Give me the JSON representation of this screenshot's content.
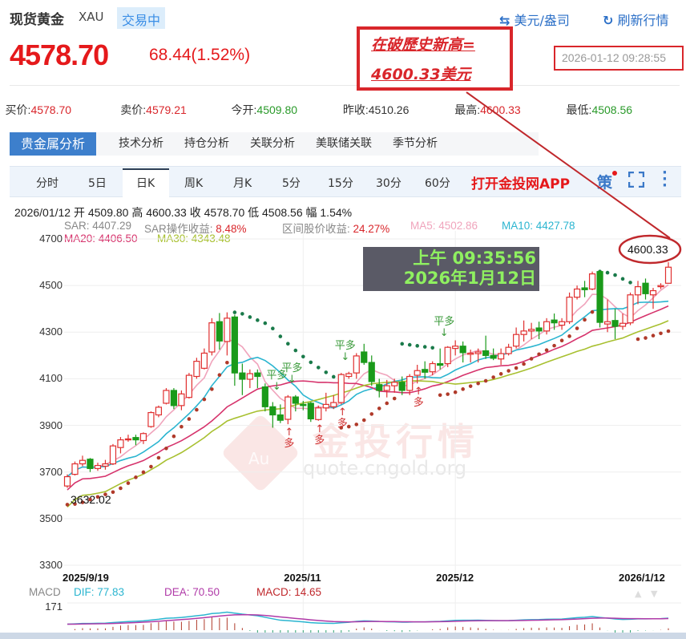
{
  "header": {
    "title": "现货黄金",
    "symbol": "XAU",
    "status": "交易中",
    "unit_btn": "美元/盎司",
    "refresh_btn": "刷新行情",
    "price": "4578.70",
    "change": "68.44(1.52%)",
    "timestamp": "2026-01-12 09:28:55"
  },
  "quote": [
    {
      "label": "买价:",
      "value": "4578.70",
      "color": "red"
    },
    {
      "label": "卖价:",
      "value": "4579.21",
      "color": "red"
    },
    {
      "label": "今开:",
      "value": "4509.80",
      "color": "green"
    },
    {
      "label": "昨收:",
      "value": "4510.26",
      "color": ""
    },
    {
      "label": "最高:",
      "value": "4600.33",
      "color": "red"
    },
    {
      "label": "最低:",
      "value": "4508.56",
      "color": "green"
    }
  ],
  "tabs": [
    "贵金属分析",
    "技术分析",
    "持仓分析",
    "关联分析",
    "美联储关联",
    "季节分析"
  ],
  "periods": [
    "分时",
    "5日",
    "日K",
    "周K",
    "月K",
    "5分",
    "15分",
    "30分",
    "60分"
  ],
  "app_link": "打开金投网APP",
  "strategy_label": "策",
  "info_line": "2026/01/12  开 4509.80  高 4600.33  收 4578.70  低 4508.56  幅 1.54%",
  "indicators": {
    "sar": "SAR: 4407.29",
    "sar_ret_label": "SAR操作收益: ",
    "sar_ret": "8.48%",
    "range_label": "区间股价收益: ",
    "range_ret": "24.27%",
    "ma5": "MA5: 4502.86",
    "ma10": "MA10: 4427.78",
    "ma20": "MA20: 4406.50",
    "ma30": "MA30: 4343.48"
  },
  "macd": {
    "label": "MACD",
    "dif": "DIF: 77.83",
    "dea": "DEA: 70.50",
    "macd": "MACD: 14.65",
    "axis": "171"
  },
  "annotations": {
    "callout_line1": "在破歷史新高=",
    "callout_line2": "4600.33美元",
    "time_line1": "上午 09:35:56",
    "time_line2": "2026年1月12日",
    "high_label": "4600.33",
    "low_label": "3632.02",
    "ping_duo": "平多",
    "duo": "多"
  },
  "watermark": {
    "text": "金投行情",
    "url": "quote.cngold.org",
    "logo": "Au"
  },
  "colors": {
    "up": "#e03030",
    "down": "#1a9a1a",
    "ma5": "#f0a4bc",
    "ma10": "#2bb5d0",
    "ma20": "#d6336c",
    "ma30": "#a8c030",
    "accent": "#3d7fcc"
  },
  "chart_data": {
    "type": "candlestick",
    "y_ticks": [
      4700,
      4500,
      4300,
      4100,
      3900,
      3700,
      3500,
      3300
    ],
    "ylim": [
      3300,
      4700
    ],
    "x_labels": [
      {
        "idx": 0,
        "label": "2025/9/19"
      },
      {
        "idx": 31,
        "label": "2025/11"
      },
      {
        "idx": 51,
        "label": "2025/12"
      },
      {
        "idx": 79,
        "label": "2026/1/12"
      }
    ],
    "signals_ping_duo": [
      27,
      29,
      36,
      49
    ],
    "signals_duo": [
      29,
      33,
      36,
      46
    ],
    "ohlc": [
      [
        3640,
        3690,
        3632.02,
        3680
      ],
      [
        3690,
        3745,
        3685,
        3735
      ],
      [
        3735,
        3770,
        3725,
        3750
      ],
      [
        3755,
        3760,
        3700,
        3715
      ],
      [
        3715,
        3740,
        3705,
        3728
      ],
      [
        3725,
        3752,
        3710,
        3735
      ],
      [
        3735,
        3820,
        3730,
        3812
      ],
      [
        3805,
        3850,
        3780,
        3838
      ],
      [
        3838,
        3860,
        3830,
        3842
      ],
      [
        3848,
        3860,
        3815,
        3838
      ],
      [
        3835,
        3870,
        3820,
        3865
      ],
      [
        3895,
        3960,
        3890,
        3955
      ],
      [
        3945,
        3985,
        3935,
        3978
      ],
      [
        3995,
        4060,
        3990,
        4050
      ],
      [
        4050,
        4060,
        3970,
        3985
      ],
      [
        3985,
        4050,
        3965,
        4035
      ],
      [
        4020,
        4125,
        4015,
        4115
      ],
      [
        4110,
        4190,
        4100,
        4175
      ],
      [
        4145,
        4230,
        4140,
        4210
      ],
      [
        4215,
        4360,
        4200,
        4340
      ],
      [
        4345,
        4382,
        4225,
        4262
      ],
      [
        4260,
        4385,
        4200,
        4360
      ],
      [
        4365,
        4375,
        4070,
        4125
      ],
      [
        4125,
        4165,
        4030,
        4098
      ],
      [
        4098,
        4140,
        4060,
        4122
      ],
      [
        4125,
        4140,
        4060,
        4110
      ],
      [
        4065,
        4080,
        3960,
        3980
      ],
      [
        3980,
        4000,
        3890,
        3945
      ],
      [
        3945,
        3990,
        3910,
        3922
      ],
      [
        3926,
        4030,
        3905,
        4022
      ],
      [
        4022,
        4030,
        3960,
        3995
      ],
      [
        3990,
        4005,
        3965,
        3985
      ],
      [
        3995,
        4000,
        3915,
        3928
      ],
      [
        3925,
        3985,
        3920,
        3975
      ],
      [
        3975,
        4040,
        3960,
        3990
      ],
      [
        3980,
        4030,
        3970,
        3998
      ],
      [
        3998,
        4125,
        3990,
        4118
      ],
      [
        4110,
        4130,
        4100,
        4122
      ],
      [
        4125,
        4210,
        4100,
        4198
      ],
      [
        4215,
        4250,
        4160,
        4170
      ],
      [
        4170,
        4200,
        4070,
        4088
      ],
      [
        4075,
        4100,
        4020,
        4050
      ],
      [
        4050,
        4095,
        4020,
        4070
      ],
      [
        4070,
        4100,
        4040,
        4085
      ],
      [
        4085,
        4110,
        4030,
        4050
      ],
      [
        4050,
        4120,
        4030,
        4110
      ],
      [
        4115,
        4160,
        4080,
        4135
      ],
      [
        4140,
        4175,
        4100,
        4128
      ],
      [
        4130,
        4175,
        4115,
        4165
      ],
      [
        4165,
        4230,
        4140,
        4158
      ],
      [
        4165,
        4240,
        4150,
        4235
      ],
      [
        4230,
        4265,
        4200,
        4240
      ],
      [
        4240,
        4260,
        4170,
        4212
      ],
      [
        4205,
        4225,
        4170,
        4210
      ],
      [
        4208,
        4230,
        4170,
        4215
      ],
      [
        4220,
        4285,
        4185,
        4200
      ],
      [
        4200,
        4230,
        4180,
        4188
      ],
      [
        4185,
        4230,
        4160,
        4208
      ],
      [
        4208,
        4250,
        4200,
        4235
      ],
      [
        4240,
        4320,
        4230,
        4290
      ],
      [
        4290,
        4350,
        4260,
        4305
      ],
      [
        4305,
        4340,
        4270,
        4312
      ],
      [
        4318,
        4345,
        4270,
        4305
      ],
      [
        4305,
        4360,
        4290,
        4345
      ],
      [
        4352,
        4380,
        4310,
        4340
      ],
      [
        4330,
        4360,
        4310,
        4345
      ],
      [
        4345,
        4470,
        4335,
        4450
      ],
      [
        4450,
        4500,
        4440,
        4485
      ],
      [
        4490,
        4520,
        4450,
        4482
      ],
      [
        4485,
        4560,
        4480,
        4550
      ],
      [
        4560,
        4565,
        4320,
        4342
      ],
      [
        4335,
        4440,
        4300,
        4345
      ],
      [
        4350,
        4400,
        4270,
        4325
      ],
      [
        4325,
        4380,
        4310,
        4338
      ],
      [
        4340,
        4470,
        4330,
        4460
      ],
      [
        4460,
        4520,
        4420,
        4495
      ],
      [
        4510,
        4530,
        4440,
        4465
      ],
      [
        4460,
        4490,
        4400,
        4478
      ],
      [
        4495,
        4510,
        4485,
        4500
      ],
      [
        4509.8,
        4600.33,
        4508.56,
        4578.7
      ]
    ]
  }
}
